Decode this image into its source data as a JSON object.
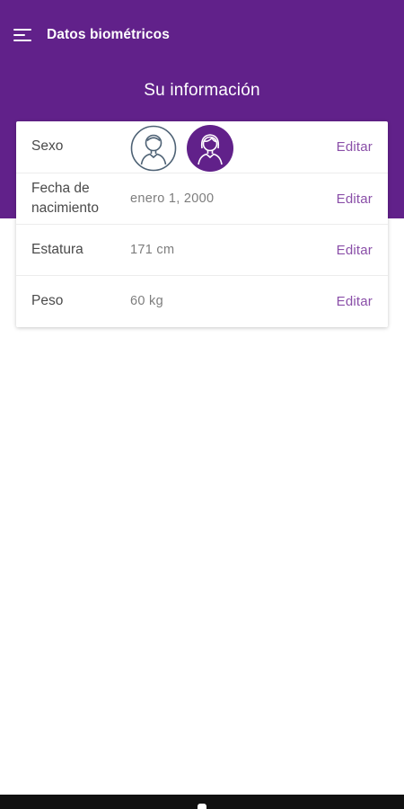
{
  "app": {
    "title": "Datos biométricos",
    "menu_icon": "menu-icon"
  },
  "page": {
    "heading": "Su información"
  },
  "colors": {
    "header": "#61218a",
    "accent": "#8a4fa8",
    "avatar_selected": "#61218a",
    "avatar_unselected_stroke": "#4e6275"
  },
  "fields": {
    "sex": {
      "label": "Sexo",
      "options": [
        {
          "icon": "male-avatar-icon",
          "selected": false
        },
        {
          "icon": "female-avatar-icon",
          "selected": true
        }
      ],
      "edit": "Editar"
    },
    "birthdate": {
      "label": "Fecha de nacimiento",
      "value": "enero 1, 2000",
      "edit": "Editar"
    },
    "height": {
      "label": "Estatura",
      "value": "171 cm",
      "edit": "Editar"
    },
    "weight": {
      "label": "Peso",
      "value": "60 kg",
      "edit": "Editar"
    }
  }
}
